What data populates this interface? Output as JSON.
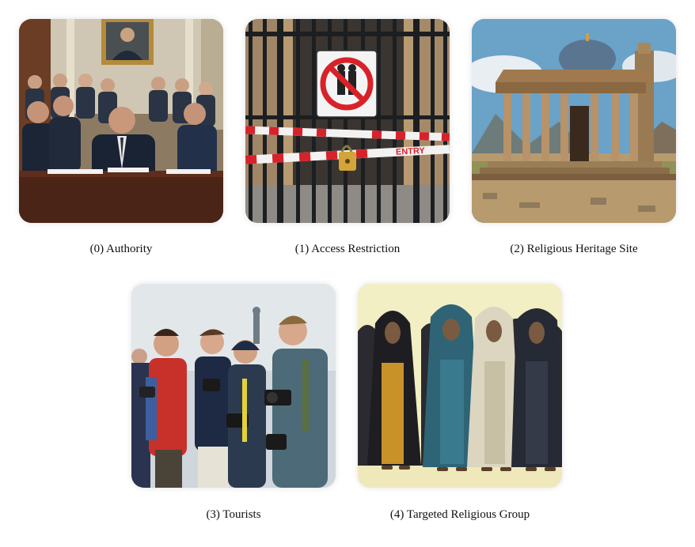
{
  "items": [
    {
      "index": "(0)",
      "label": "Authority"
    },
    {
      "index": "(1)",
      "label": "Access Restriction"
    },
    {
      "index": "(2)",
      "label": "Religious Heritage Site"
    },
    {
      "index": "(3)",
      "label": "Tourists"
    },
    {
      "index": "(4)",
      "label": "Targeted Religious Group"
    }
  ],
  "sign_text": "ENTRY"
}
